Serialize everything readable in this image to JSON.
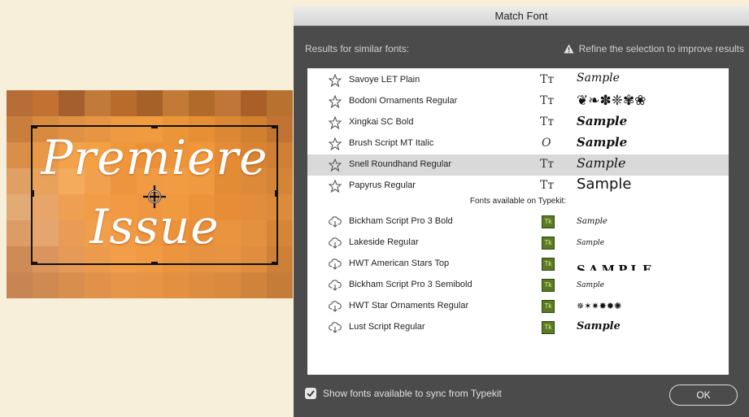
{
  "canvas": {
    "word1": "Premiere",
    "word2": "Issue",
    "pixel_colors": [
      "#b76d37",
      "#c27133",
      "#a55e2d",
      "#c27a3a",
      "#b96b2b",
      "#a66128",
      "#c37a36",
      "#b06a2a",
      "#c07638",
      "#a95f26",
      "#b8722f",
      "#c87f3d",
      "#d88a3f",
      "#e19143",
      "#e79544",
      "#ed9a42",
      "#f09b40",
      "#e99538",
      "#e68f35",
      "#dc8733",
      "#d0802f",
      "#c07332",
      "#d98e4a",
      "#e89948",
      "#f2a24a",
      "#f4a143",
      "#f0973b",
      "#ec9137",
      "#ee9438",
      "#f09739",
      "#e58b34",
      "#d98431",
      "#d07f34",
      "#e0a064",
      "#e8a25b",
      "#f4ab5c",
      "#f0a04e",
      "#ec953e",
      "#f09b43",
      "#f29c42",
      "#ef9a3f",
      "#e28c36",
      "#dc8a39",
      "#d48436",
      "#e2aa74",
      "#e7a56a",
      "#ef9f52",
      "#f19c46",
      "#f19a43",
      "#ee9640",
      "#f09a40",
      "#ec933a",
      "#e68d36",
      "#e28d3b",
      "#dd8b3b",
      "#dc9c66",
      "#e4a56e",
      "#ea9b55",
      "#f0a04c",
      "#f29a44",
      "#ee963f",
      "#ec923a",
      "#e98f38",
      "#ea9440",
      "#e3903f",
      "#d68536",
      "#cd8b58",
      "#d9955d",
      "#e59a57",
      "#ec9b4d",
      "#f29d47",
      "#f09a43",
      "#eb953f",
      "#e79240",
      "#e79342",
      "#e08d3f",
      "#cf8038",
      "#c78553",
      "#cf8a51",
      "#d88e4c",
      "#e1924a",
      "#e79548",
      "#e79446",
      "#e39041",
      "#de8c3f",
      "#d98a3e",
      "#d0843b",
      "#c57c38"
    ]
  },
  "dialog": {
    "title": "Match Font",
    "results_label": "Results for similar fonts:",
    "hint": "Refine the selection to improve results",
    "installed_fonts": [
      {
        "name": "Savoye LET Plain",
        "type_icon": "Tт",
        "sample": "Sample",
        "selected": false
      },
      {
        "name": "Bodoni Ornaments Regular",
        "type_icon": "Tт",
        "sample": "❦❧✽❈✾❀",
        "selected": false
      },
      {
        "name": "Xingkai SC Bold",
        "type_icon": "Tт",
        "sample": "Sample",
        "selected": false
      },
      {
        "name": "Brush Script MT Italic",
        "type_icon": "O",
        "sample": "Sample",
        "selected": false
      },
      {
        "name": "Snell Roundhand Regular",
        "type_icon": "Tт",
        "sample": "Sample",
        "selected": true
      },
      {
        "name": "Papyrus Regular",
        "type_icon": "Tт",
        "sample": "Sample",
        "selected": false
      }
    ],
    "typekit_label": "Fonts available on Typekit:",
    "typekit_fonts": [
      {
        "name": "Bickham Script Pro 3 Bold",
        "badge": "Tk",
        "sample": "Sample"
      },
      {
        "name": "Lakeside Regular",
        "badge": "Tk",
        "sample": "Sample"
      },
      {
        "name": "HWT American Stars Top",
        "badge": "Tk",
        "sample": "SAMPLE"
      },
      {
        "name": "Bickham Script Pro 3 Semibold",
        "badge": "Tk",
        "sample": "Sample"
      },
      {
        "name": "HWT Star Ornaments Regular",
        "badge": "Tk",
        "sample": "✵✶✷✸✹✺"
      },
      {
        "name": "Lust Script Regular",
        "badge": "Tk",
        "sample": "Sample"
      }
    ],
    "show_typekit_label": "Show fonts available to sync from Typekit",
    "show_typekit_checked": true,
    "ok_label": "OK"
  }
}
